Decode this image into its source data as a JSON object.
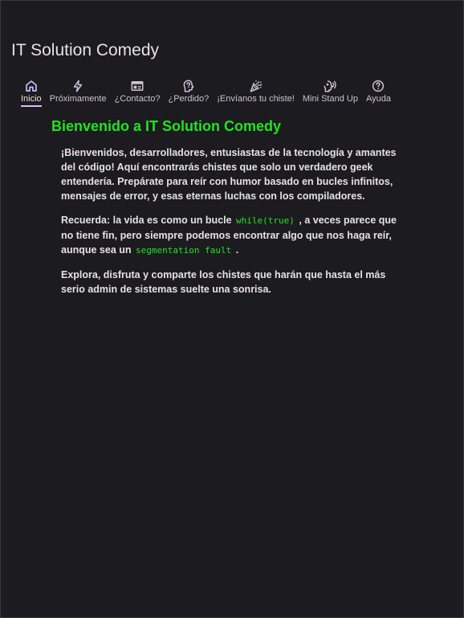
{
  "app": {
    "title": "IT Solution Comedy"
  },
  "nav": {
    "items": [
      {
        "label": "Inicio",
        "icon": "home-icon",
        "active": true
      },
      {
        "label": "Próximamente",
        "icon": "lightning-icon",
        "active": false
      },
      {
        "label": "¿Contacto?",
        "icon": "contact-card-icon",
        "active": false
      },
      {
        "label": "¿Perdido?",
        "icon": "confused-head-icon",
        "active": false
      },
      {
        "label": "¡Envíanos tu chiste!",
        "icon": "celebration-icon",
        "active": false
      },
      {
        "label": "Mini Stand Up",
        "icon": "voice-icon",
        "active": false
      },
      {
        "label": "Ayuda",
        "icon": "help-icon",
        "active": false
      }
    ]
  },
  "main": {
    "heading": "Bienvenido a IT Solution Comedy",
    "p1": "¡Bienvenidos, desarrolladores, entusiastas de la tecnología y amantes del código! Aquí encontrarás chistes que solo un verdadero geek entendería. Prepárate para reír con humor basado en bucles infinitos, mensajes de error, y esas eternas luchas con los compiladores.",
    "p2_before": "Recuerda: la vida es como un bucle ",
    "p2_code1": "while(true)",
    "p2_middle": " , a veces parece que no tiene fin, pero siempre podemos encontrar algo que nos haga reír, aunque sea un ",
    "p2_code2": "segmentation fault",
    "p2_after": " .",
    "p3": "Explora, disfruta y comparte los chistes que harán que hasta el más serio admin de sistemas suelte una sonrisa."
  },
  "colors": {
    "background": "#1c1b1f",
    "accent_green": "#21e321",
    "active_indicator": "#d0bcff",
    "text": "#e6e1e5"
  }
}
